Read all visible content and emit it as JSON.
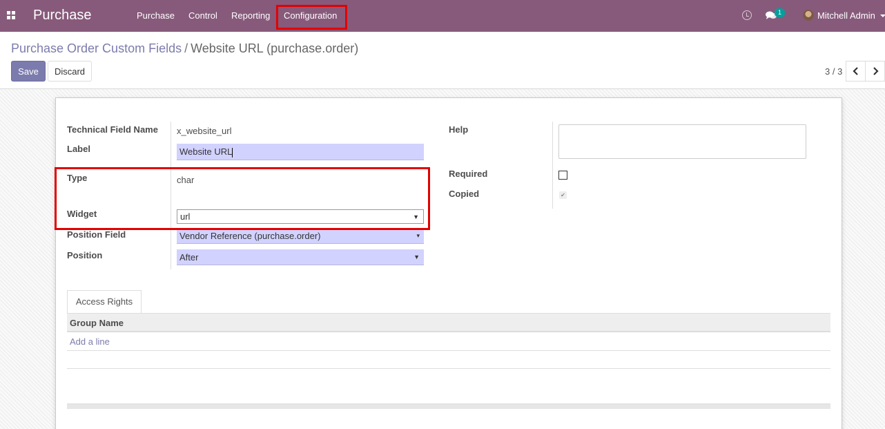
{
  "navbar": {
    "brand": "Purchase",
    "menu": [
      "Purchase",
      "Control",
      "Reporting",
      "Configuration"
    ],
    "notification_count": "1",
    "user_name": "Mitchell Admin"
  },
  "breadcrumb": {
    "parent": "Purchase Order Custom Fields",
    "separator": "/",
    "current": "Website URL (purchase.order)"
  },
  "actions": {
    "save": "Save",
    "discard": "Discard"
  },
  "pager": {
    "value": "3 / 3"
  },
  "form": {
    "technical_name": {
      "label": "Technical Field Name",
      "value": "x_website_url"
    },
    "label_field": {
      "label": "Label",
      "value": "Website URL"
    },
    "type": {
      "label": "Type",
      "value": "char"
    },
    "widget": {
      "label": "Widget",
      "value": "url"
    },
    "position_field": {
      "label": "Position Field",
      "value": "Vendor Reference (purchase.order)"
    },
    "position": {
      "label": "Position",
      "value": "After"
    },
    "help": {
      "label": "Help",
      "value": ""
    },
    "required": {
      "label": "Required",
      "checked": false
    },
    "copied": {
      "label": "Copied",
      "checked": true
    }
  },
  "tabs": {
    "access_rights": "Access Rights"
  },
  "table": {
    "column": "Group Name",
    "add_line": "Add a line"
  },
  "colors": {
    "navbar": "#875a7b",
    "primary": "#7c7bad",
    "highlight": "#e10000"
  }
}
